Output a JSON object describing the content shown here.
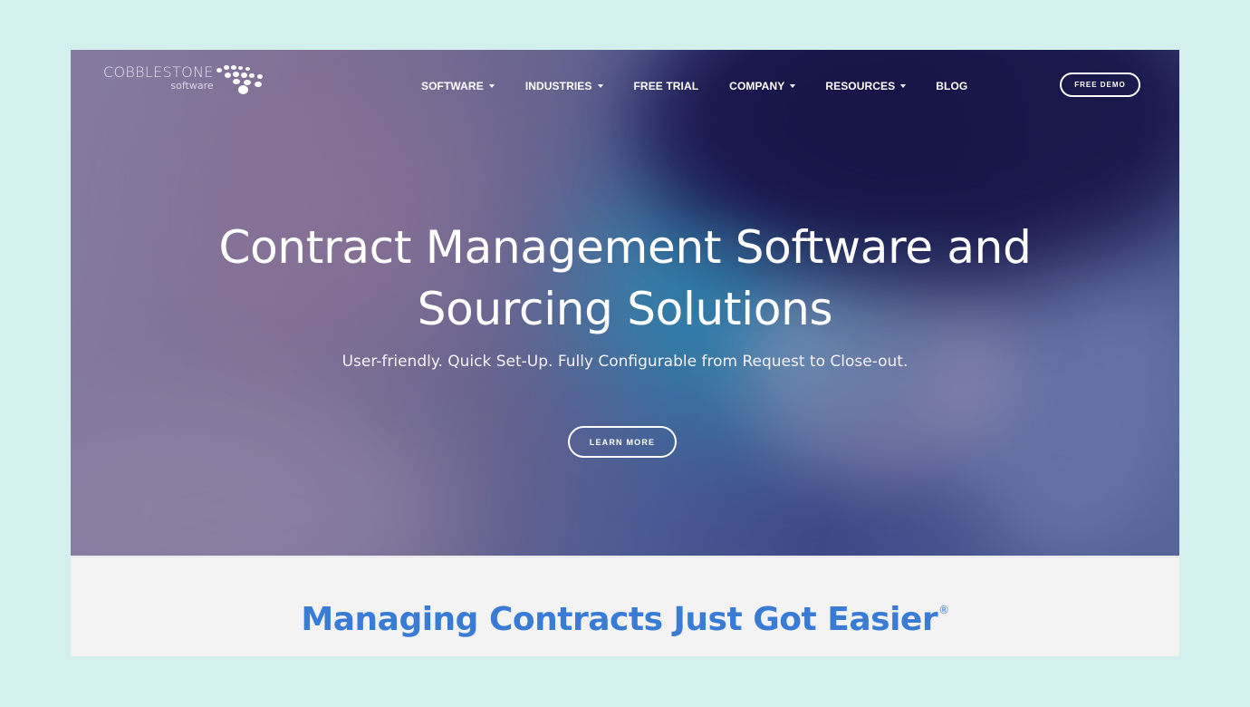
{
  "logo": {
    "name": "COBBLESTONE",
    "sub": "software",
    "icon": "cobblestone-dots-icon"
  },
  "nav": {
    "items": [
      {
        "label": "SOFTWARE",
        "has_dropdown": true
      },
      {
        "label": "INDUSTRIES",
        "has_dropdown": true
      },
      {
        "label": "FREE TRIAL",
        "has_dropdown": false
      },
      {
        "label": "COMPANY",
        "has_dropdown": true
      },
      {
        "label": "RESOURCES",
        "has_dropdown": true
      },
      {
        "label": "BLOG",
        "has_dropdown": false
      }
    ],
    "cta_label": "FREE DEMO"
  },
  "hero": {
    "title_line1": "Contract Management Software and",
    "title_line2": "Sourcing Solutions",
    "subtitle": "User-friendly. Quick Set-Up. Fully Configurable from Request to Close-out.",
    "button_label": "LEARN MORE"
  },
  "section": {
    "title": "Managing Contracts Just Got Easier",
    "trademark": "®"
  },
  "colors": {
    "page_background": "#d3f0ef",
    "accent_blue": "#3a7bd5",
    "hero_navy": "#171447",
    "section_background": "#f3f3f3"
  }
}
